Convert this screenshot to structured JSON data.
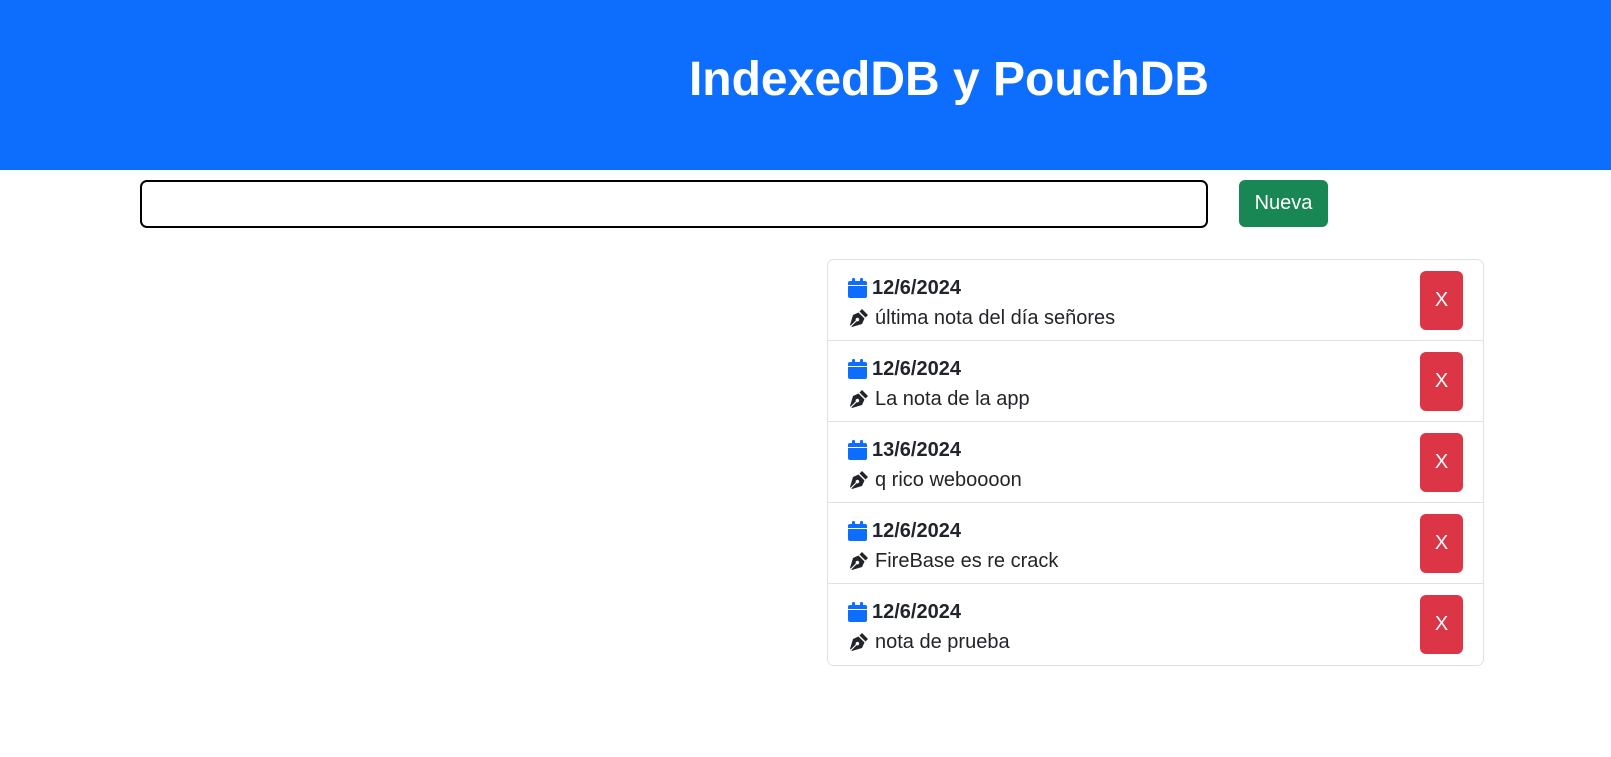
{
  "header": {
    "title": "IndexedDB y PouchDB",
    "background_color": "#0d6efd"
  },
  "form": {
    "input_value": "",
    "input_placeholder": "",
    "new_button_label": "Nueva",
    "new_button_color": "#198754"
  },
  "notes": [
    {
      "date": "12/6/2024",
      "text": "última nota del día señores",
      "delete_label": "X"
    },
    {
      "date": "12/6/2024",
      "text": "La nota de la app",
      "delete_label": "X"
    },
    {
      "date": "13/6/2024",
      "text": "q rico weboooon",
      "delete_label": "X"
    },
    {
      "date": "12/6/2024",
      "text": "FireBase es re crack",
      "delete_label": "X"
    },
    {
      "date": "12/6/2024",
      "text": "nota de prueba",
      "delete_label": "X"
    }
  ],
  "icons": {
    "date": "calendar-icon",
    "note": "pen-nib-icon"
  },
  "colors": {
    "accent": "#0d6efd",
    "danger": "#dc3545",
    "success": "#198754"
  }
}
